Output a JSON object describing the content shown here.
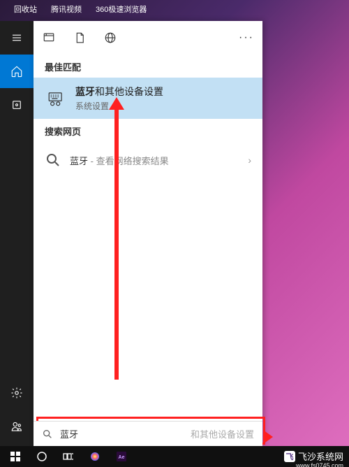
{
  "desktop": {
    "icons": [
      "回收站",
      "腾讯视频",
      "360极速浏览器"
    ]
  },
  "rail": {
    "menu": "menu",
    "home": "home",
    "cube": "collections"
  },
  "tabs": {
    "all": "all",
    "documents": "documents",
    "web": "web",
    "more": "···"
  },
  "sections": {
    "best_match": "最佳匹配",
    "web_search": "搜索网页"
  },
  "result": {
    "highlight": "蓝牙",
    "rest": "和其他设备设置",
    "subtitle": "系统设置"
  },
  "web": {
    "query": "蓝牙",
    "suffix": " - 查看网络搜索结果"
  },
  "search": {
    "value": "蓝牙",
    "placeholder": "和其他设备设置"
  },
  "watermark": {
    "text": "飞沙系统网",
    "url": "www.fs0745.com"
  }
}
